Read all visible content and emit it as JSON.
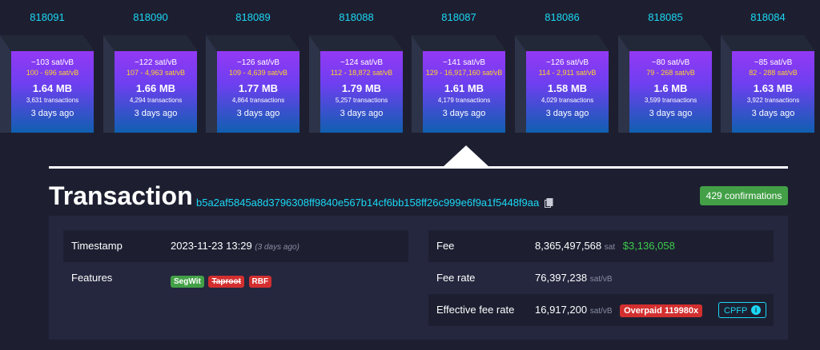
{
  "blocks": [
    {
      "height": "818091",
      "median_fee": "~103 sat/vB",
      "fee_range": "100 - 696 sat/vB",
      "size": "1.64 MB",
      "tx_count": "3,631 transactions",
      "age": "3 days ago"
    },
    {
      "height": "818090",
      "median_fee": "~122 sat/vB",
      "fee_range": "107 - 4,963 sat/vB",
      "size": "1.66 MB",
      "tx_count": "4,294 transactions",
      "age": "3 days ago"
    },
    {
      "height": "818089",
      "median_fee": "~126 sat/vB",
      "fee_range": "109 - 4,639 sat/vB",
      "size": "1.77 MB",
      "tx_count": "4,864 transactions",
      "age": "3 days ago"
    },
    {
      "height": "818088",
      "median_fee": "~124 sat/vB",
      "fee_range": "112 - 18,872 sat/vB",
      "size": "1.79 MB",
      "tx_count": "5,257 transactions",
      "age": "3 days ago"
    },
    {
      "height": "818087",
      "median_fee": "~141 sat/vB",
      "fee_range": "129 - 16,917,160 sat/vB",
      "size": "1.61 MB",
      "tx_count": "4,179 transactions",
      "age": "3 days ago",
      "selected": true
    },
    {
      "height": "818086",
      "median_fee": "~126 sat/vB",
      "fee_range": "114 - 2,911 sat/vB",
      "size": "1.58 MB",
      "tx_count": "4,029 transactions",
      "age": "3 days ago"
    },
    {
      "height": "818085",
      "median_fee": "~80 sat/vB",
      "fee_range": "79 - 268 sat/vB",
      "size": "1.6 MB",
      "tx_count": "3,599 transactions",
      "age": "3 days ago"
    },
    {
      "height": "818084",
      "median_fee": "~85 sat/vB",
      "fee_range": "82 - 288 sat/vB",
      "size": "1.63 MB",
      "tx_count": "3,922 transactions",
      "age": "3 days ago"
    }
  ],
  "transaction": {
    "title": "Transaction",
    "txid": "b5a2af5845a8d3796308ff9840e567b14cf6bb158ff26c999e6f9a1f5448f9aa",
    "confirmations": "429 confirmations"
  },
  "details": {
    "timestamp_label": "Timestamp",
    "timestamp_value": "2023-11-23 13:29",
    "timestamp_ago": "(3 days ago)",
    "features_label": "Features",
    "features": [
      "SegWit",
      "Taproot",
      "RBF"
    ],
    "fee_label": "Fee",
    "fee_value": "8,365,497,568",
    "fee_unit": "sat",
    "fee_usd": "$3,136,058",
    "fee_rate_label": "Fee rate",
    "fee_rate_value": "76,397,238",
    "fee_rate_unit": "sat/vB",
    "effective_label": "Effective fee rate",
    "effective_value": "16,917,200",
    "effective_unit": "sat/vB",
    "overpaid": "Overpaid 119980x",
    "cpfp": "CPFP"
  },
  "colors": {
    "background": "#1d1f31",
    "panel": "#24273e",
    "accent": "#1bd8f4",
    "fee_range": "#ffd42a",
    "green": "#43a047",
    "red": "#d32f2f"
  }
}
